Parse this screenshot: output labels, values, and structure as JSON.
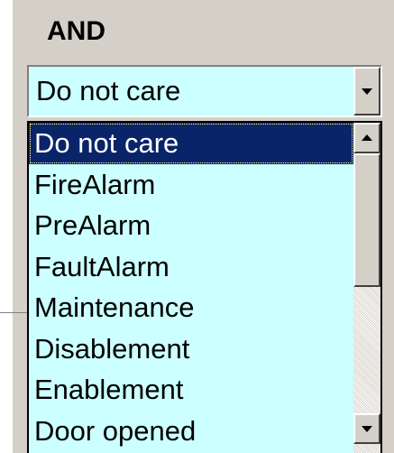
{
  "group": {
    "label": "AND"
  },
  "combo": {
    "value": "Do not care"
  },
  "dropdown": {
    "items": [
      {
        "label": "Do not care",
        "selected": true
      },
      {
        "label": "FireAlarm"
      },
      {
        "label": "PreAlarm"
      },
      {
        "label": "FaultAlarm"
      },
      {
        "label": "Maintenance"
      },
      {
        "label": "Disablement"
      },
      {
        "label": "Enablement"
      },
      {
        "label": "Door opened"
      }
    ]
  },
  "colors": {
    "background": "#d4d0c8",
    "field": "#ccffff",
    "selection": "#0a246a"
  },
  "icons": {
    "combo_arrow": "chevron-down-icon",
    "scroll_up": "scroll-up-arrow-icon",
    "scroll_down": "scroll-down-arrow-icon"
  }
}
